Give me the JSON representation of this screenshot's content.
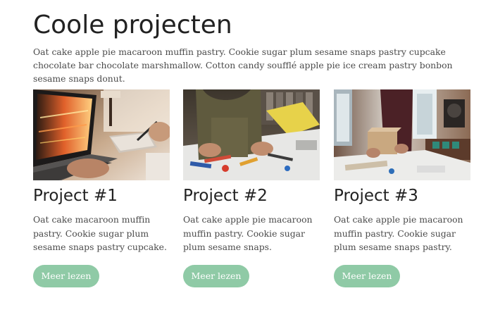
{
  "page": {
    "title": "Coole projecten",
    "intro": "Oat cake apple pie macaroon muffin pastry. Cookie sugar plum sesame snaps pastry cupcake chocolate bar chocolate marshmallow. Cotton candy soufflé apple pie ice cream pastry bonbon sesame snaps donut."
  },
  "colors": {
    "button_bg": "#8fcaa6",
    "button_text": "#ffffff",
    "heading": "#222222",
    "body_text": "#4a4a4a"
  },
  "projects": [
    {
      "title": "Project #1",
      "text": "Oat cake  macaroon muffin pastry. Cookie sugar plum sesame snaps pastry cupcake.",
      "button_label": "Meer lezen",
      "image": "laptop-and-tablet-photo"
    },
    {
      "title": "Project #2",
      "text": "Oat cake apple pie macaroon muffin pastry. Cookie sugar plum sesame snaps.",
      "button_label": "Meer lezen",
      "image": "workbench-tools-photo"
    },
    {
      "title": "Project #3",
      "text": "Oat cake apple pie macaroon muffin pastry. Cookie sugar plum sesame snaps pastry.",
      "button_label": "Meer lezen",
      "image": "workshop-packing-photo"
    }
  ]
}
